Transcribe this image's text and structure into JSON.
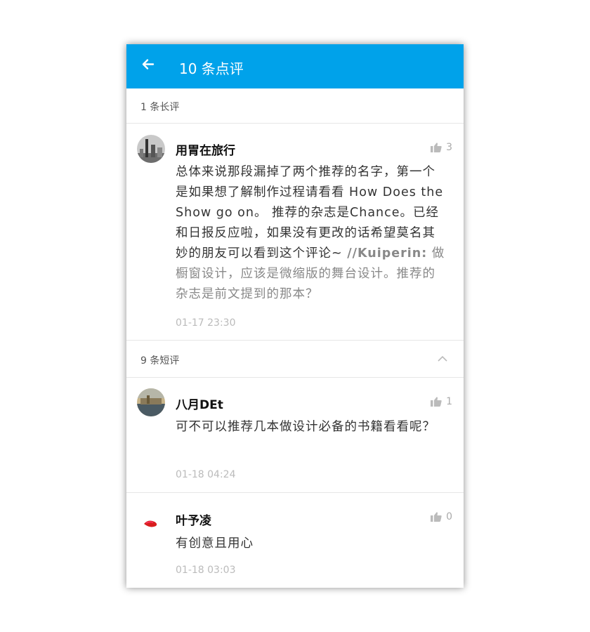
{
  "appbar": {
    "title": "10 条点评",
    "back_icon": "arrow-left-icon",
    "bg_color": "#00a2ea"
  },
  "long_section": {
    "label": "1 条长评"
  },
  "short_section": {
    "label": "9 条短评",
    "toggle_icon": "chevron-up-icon"
  },
  "comments": [
    {
      "author": "用胃在旅行",
      "likes": "3",
      "content": "总体来说那段漏掉了两个推荐的名字，第一个是如果想了解制作过程请看看 How Does the Show go on。 推荐的杂志是Chance。已经和日报反应啦，如果没有更改的话希望莫名其妙的朋友可以看到这个评论~",
      "reply_author": "//Kuiperin:",
      "reply_text": " 做橱窗设计，应该是微缩版的舞台设计。推荐的杂志是前文提到的那本？",
      "time": "01-17 23:30"
    },
    {
      "author": "八月DEt",
      "likes": "1",
      "content": "可不可以推荐几本做设计必备的书籍看看呢？",
      "time": "01-18 04:24"
    },
    {
      "author": "叶予凌",
      "likes": "0",
      "content": "有创意且用心",
      "time": "01-18 03:03"
    }
  ]
}
